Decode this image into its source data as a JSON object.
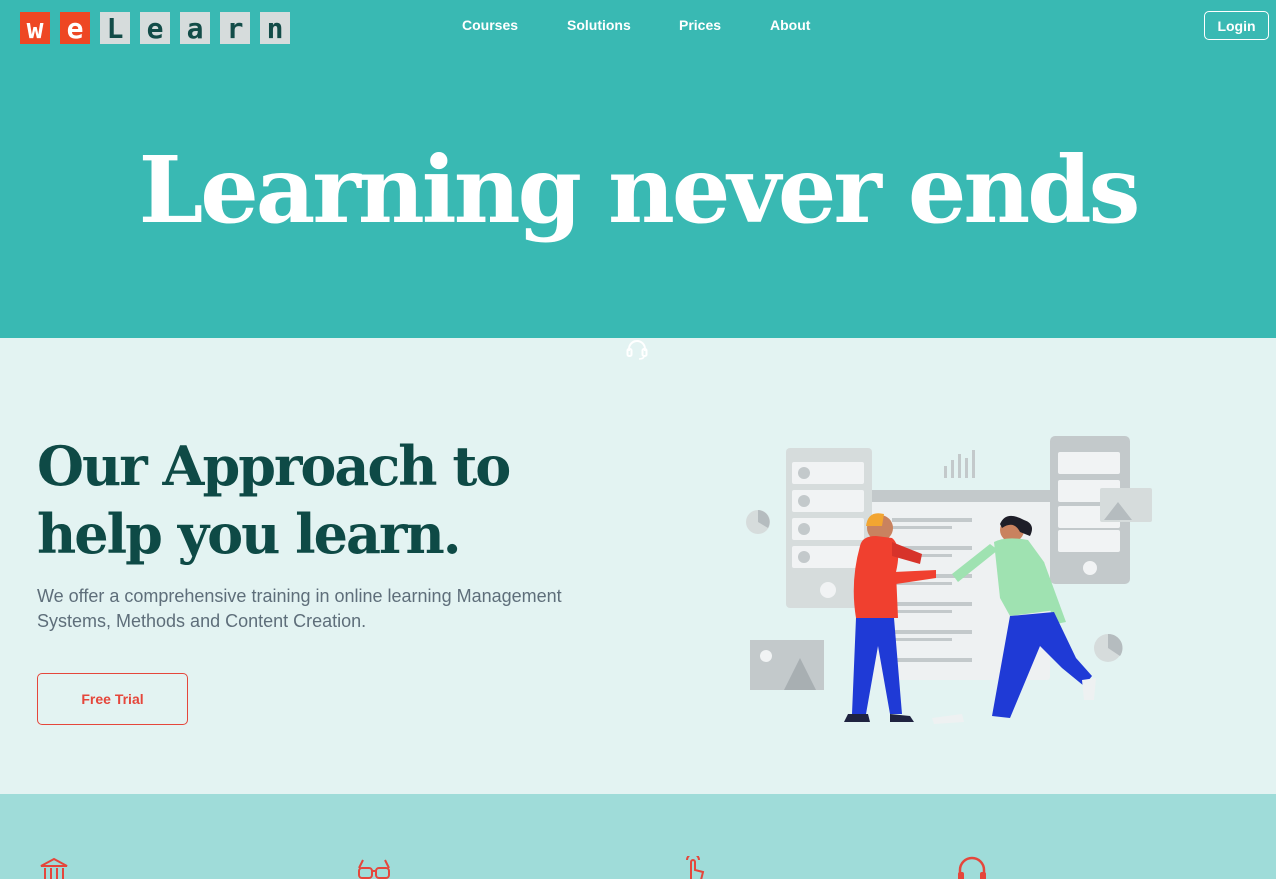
{
  "brand": {
    "logo_letters": [
      "w",
      "e",
      "L",
      "e",
      "a",
      "r",
      "n"
    ],
    "logo_text": "weLearn",
    "colors": {
      "orange": "#ee4723",
      "teal": "#39b9b3",
      "dark_teal": "#0e4a46",
      "accent_red": "#e5463b"
    }
  },
  "nav": {
    "items": [
      {
        "label": "Courses"
      },
      {
        "label": "Solutions"
      },
      {
        "label": "Prices"
      },
      {
        "label": "About"
      }
    ],
    "login_label": "Login"
  },
  "hero": {
    "title": "Learning never ends"
  },
  "approach": {
    "title_line1": "Our Approach to",
    "title_line2": "help you learn.",
    "description": "We offer a comprehensive training in online learning Management Systems, Methods and Content Creation.",
    "cta_label": "Free Trial",
    "support_icon": "headset-icon",
    "illustration": "two-people-high-five-illustration"
  },
  "features": {
    "icons": [
      "bank-icon",
      "glasses-icon",
      "pointer-hand-icon",
      "headphones-icon"
    ]
  }
}
